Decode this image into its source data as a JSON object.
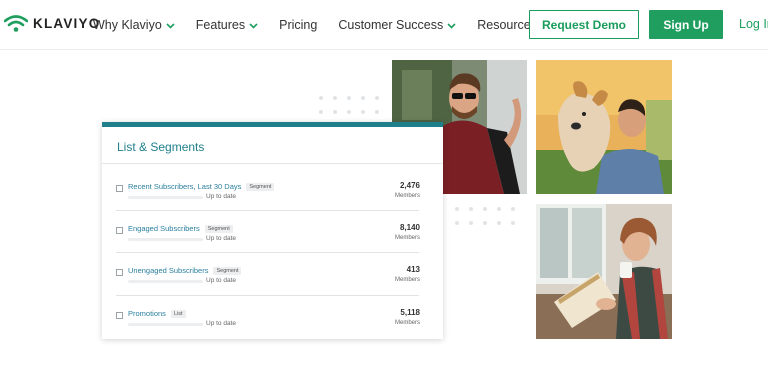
{
  "nav": {
    "logo_text": "KLAVIYO",
    "menu": [
      {
        "label": "Why Klaviyo",
        "has_dropdown": true
      },
      {
        "label": "Features",
        "has_dropdown": true
      },
      {
        "label": "Pricing",
        "has_dropdown": false
      },
      {
        "label": "Customer Success",
        "has_dropdown": true
      },
      {
        "label": "Resources",
        "has_dropdown": true
      }
    ],
    "request_demo": "Request Demo",
    "sign_up": "Sign Up",
    "log_in": "Log In"
  },
  "panel": {
    "title": "List & Segments",
    "rows": [
      {
        "name": "Recent Subscribers, Last 30 Days",
        "tag": "Segment",
        "status": "Up to date",
        "count": "2,476",
        "unit": "Members"
      },
      {
        "name": "Engaged Subscribers",
        "tag": "Segment",
        "status": "Up to date",
        "count": "8,140",
        "unit": "Members"
      },
      {
        "name": "Unengaged Subscribers",
        "tag": "Segment",
        "status": "Up to date",
        "count": "413",
        "unit": "Members"
      },
      {
        "name": "Promotions",
        "tag": "List",
        "status": "Up to date",
        "count": "5,118",
        "unit": "Members"
      }
    ]
  },
  "colors": {
    "brand_green": "#1f9e5f",
    "panel_accent": "#1f7f8b",
    "link_blue": "#2a7f9e"
  },
  "icons": [
    "klaviyo-logo-icon",
    "chevron-down-icon",
    "checkbox-icon"
  ]
}
